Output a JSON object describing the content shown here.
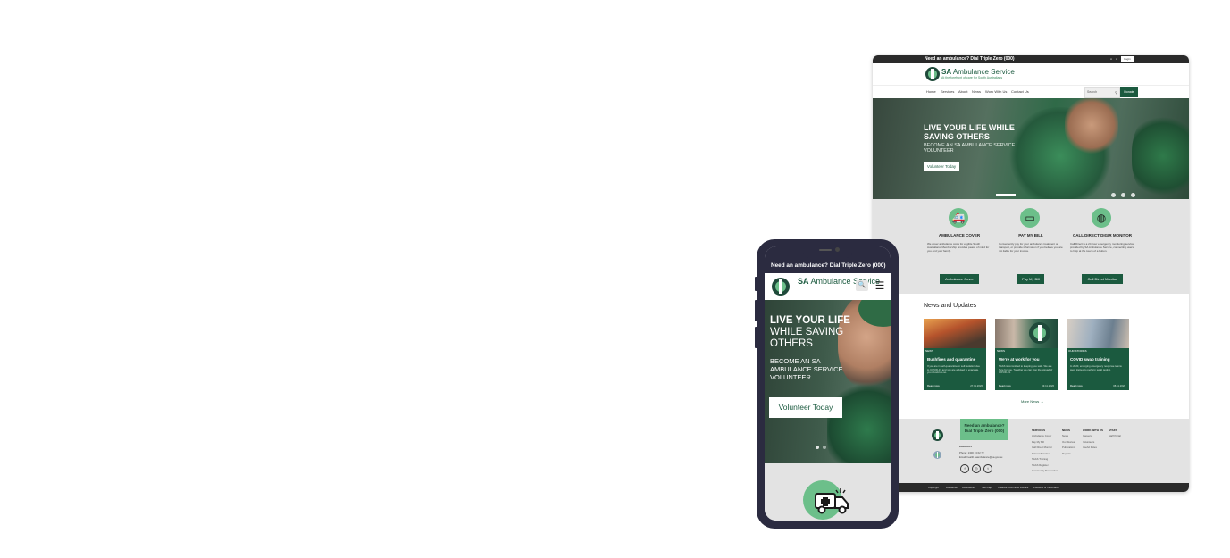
{
  "desktop": {
    "topbar": {
      "call_text": "Need an ambulance? Dial Triple Zero (000)",
      "font_a": "A",
      "font_b": "A",
      "login": "Login"
    },
    "header": {
      "brand_bold": "SA",
      "brand_rest": " Ambulance Service",
      "tagline": "At the forefront of care for South Australians"
    },
    "nav": {
      "items": [
        "Home",
        "Services",
        "About",
        "News",
        "Work With Us",
        "Contact Us"
      ],
      "search_placeholder": "Search",
      "donate": "Donate"
    },
    "hero": {
      "title": "LIVE YOUR LIFE WHILE SAVING OTHERS",
      "subtitle": "BECOME AN SA AMBULANCE SERVICE VOLUNTEER",
      "cta": "Volunteer Today"
    },
    "services": [
      {
        "title": "AMBULANCE COVER",
        "text": "We cover ambulance costs for eligible South Australians. Membership provides peace of mind for you and your family.",
        "button": "Ambulance Cover",
        "icon": "ambulance-icon"
      },
      {
        "title": "PAY MY BILL",
        "text": "Conveniently pay for your ambulance treatment or transport, or provide information if you believe you are not liable for your invoice.",
        "button": "Pay My Bill",
        "icon": "credit-card-icon"
      },
      {
        "title": "CALL DIRECT DIGIR MONITOR",
        "text": "Call Direct is a 24 hour emergency monitoring service provided by SA Ambulance Service, connecting users to help at the touch of a button.",
        "button": "Call Direct Monitor",
        "icon": "phone-monitor-icon"
      }
    ],
    "news": {
      "heading": "News and Updates",
      "cards": [
        {
          "tag": "NEWS",
          "title": "Bushfires and quarantine",
          "text": "If you are in self-quarantine or self-isolation due to COVID-19 and you are advised to evacuate, you should do so.",
          "read_more": "Read more",
          "date": "27.11.2020"
        },
        {
          "tag": "NEWS",
          "title": "We're at work for you",
          "text": "SAAS is committed to keeping you safe. We are here for you. Together we can stop the spread of COVID-19.",
          "read_more": "Read more",
          "date": "19.11.2020"
        },
        {
          "tag": "OUR STORIES",
          "title": "COVID swab training",
          "text": "In 2020, emerging emergency response teams were trained to perform swab testing.",
          "read_more": "Read more",
          "date": "08.11.2020"
        }
      ],
      "more": "More News →"
    },
    "footer": {
      "cta": "Need an ambulance? Dial Triple Zero (000)",
      "contact_heading": "CONTACT",
      "phone": "Phone: 1300 13 62 72",
      "email": "Email: health.saambulance@sa.gov.au",
      "columns": [
        {
          "heading": "SERVICES",
          "links": [
            "Ambulance Cover",
            "Pay My Bill",
            "Call Direct Monitor",
            "Patient Transfer",
            "SAAS Training",
            "SAAS Register",
            "Community Responders"
          ]
        },
        {
          "heading": "NEWS",
          "links": [
            "News",
            "Our Stories",
            "Publications",
            "Reports"
          ]
        },
        {
          "heading": "WORK WITH US",
          "links": [
            "Careers",
            "Volunteers",
            "Useful Roles"
          ]
        },
        {
          "heading": "STAFF",
          "links": [
            "Staff Portal"
          ]
        }
      ],
      "social": [
        "f",
        "◎",
        "t"
      ]
    },
    "legal": [
      "Copyright",
      "Disclaimer",
      "Accessibility",
      "Site map",
      "Creative Commons Licence",
      "Freedom of Information"
    ]
  },
  "phone": {
    "topbar": "Need an ambulance? Dial Triple Zero (000)",
    "brand_bold": "SA",
    "brand_rest": " Ambulance Service",
    "search_icon": "🔍",
    "menu_icon": "☰",
    "hero": {
      "line1": "LIVE YOUR LIFE",
      "line2": "WHILE SAVING",
      "line3": "OTHERS",
      "subtitle": "BECOME AN SA AMBULANCE SERVICE VOLUNTEER",
      "cta": "Volunteer Today"
    }
  },
  "colors": {
    "brand_green": "#1b5a3f",
    "accent_green": "#6cbf8a",
    "dark": "#2a2a2a",
    "phone_frame": "#2b2b40",
    "section_grey": "#e3e3e3"
  }
}
